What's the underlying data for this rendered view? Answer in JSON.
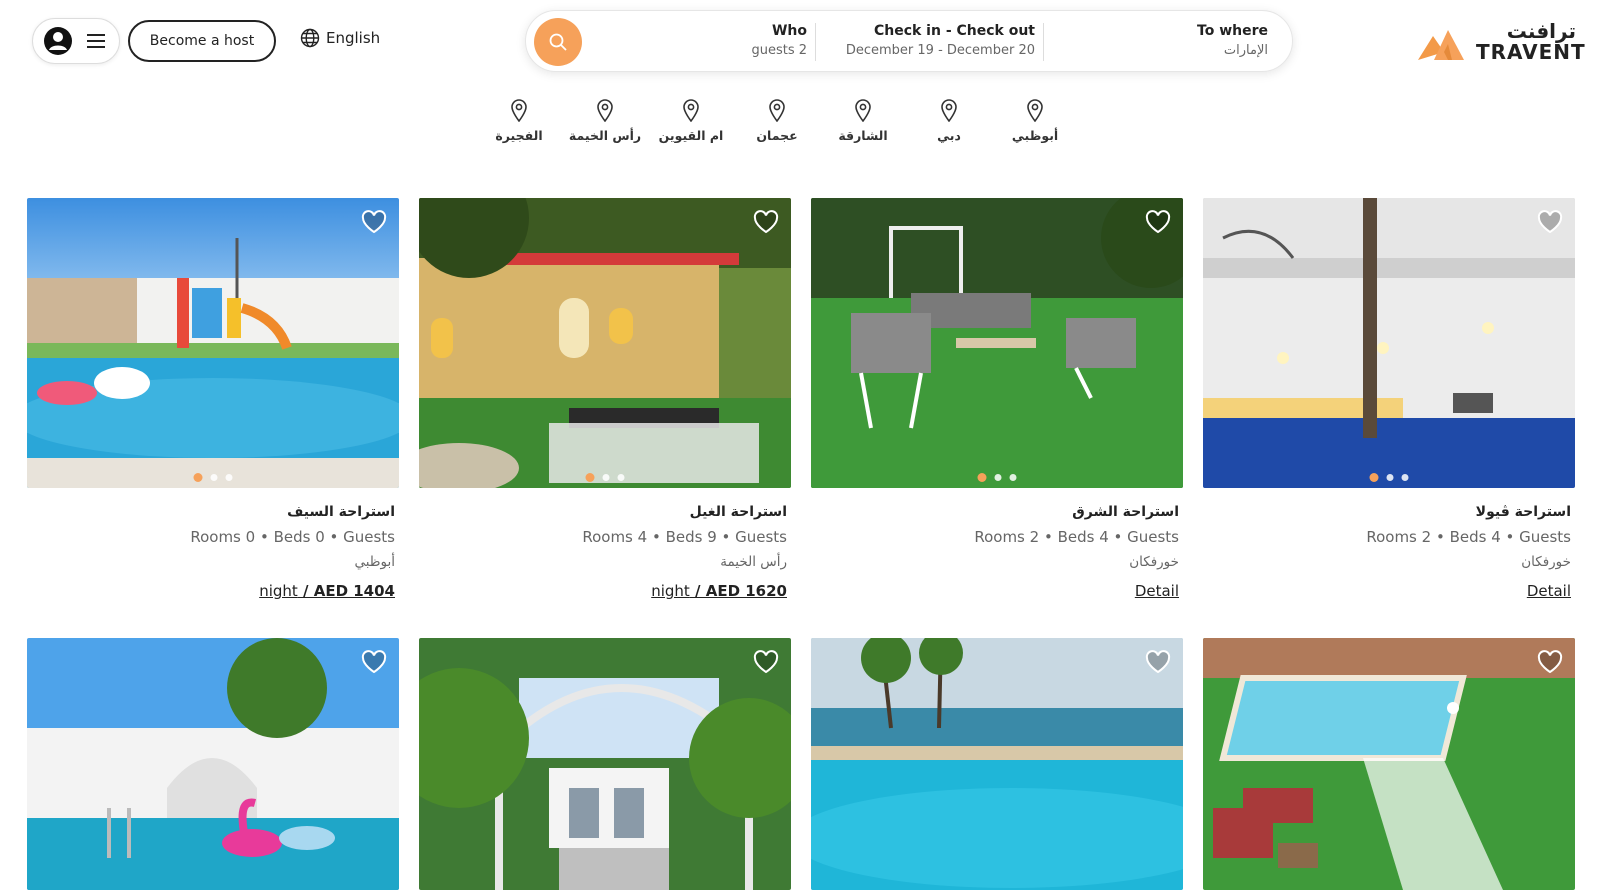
{
  "header": {
    "become_host": "Become a host",
    "language": "English",
    "search": {
      "who_label": "Who",
      "who_value": "guests 2",
      "dates_label": "Check in - Check out",
      "dates_value": "December 19 - December 20",
      "where_label": "To where",
      "where_value": "الإمارات"
    },
    "logo_ar": "ترافنت",
    "logo_en": "TRAVENT"
  },
  "categories": [
    "أبوظبي",
    "دبي",
    "الشارقة",
    "عجمان",
    "ام القيوين",
    "رأس الخيمة",
    "الفجيرة"
  ],
  "colors": {
    "accent": "#f6a15a",
    "text": "#222222",
    "muted": "#666666"
  },
  "listings": [
    {
      "title": "استراحة السيف",
      "specs": "Rooms 0 • Beds 0 • Guests",
      "location": "أبوظبي",
      "night": "night",
      "price": " / AED 1404"
    },
    {
      "title": "استراحة الغيل",
      "specs": "Rooms 4 • Beds 9 • Guests",
      "location": "رأس الخيمة",
      "night": "night",
      "price": " / AED 1620"
    },
    {
      "title": "استراحة الشرق",
      "specs": "Rooms 2 • Beds 4 • Guests",
      "location": "خورفكان",
      "link": "Detail"
    },
    {
      "title": "استراحة ڤيولا",
      "specs": "Rooms 2 • Beds 4 • Guests",
      "location": "خورفكان",
      "link": "Detail"
    }
  ]
}
